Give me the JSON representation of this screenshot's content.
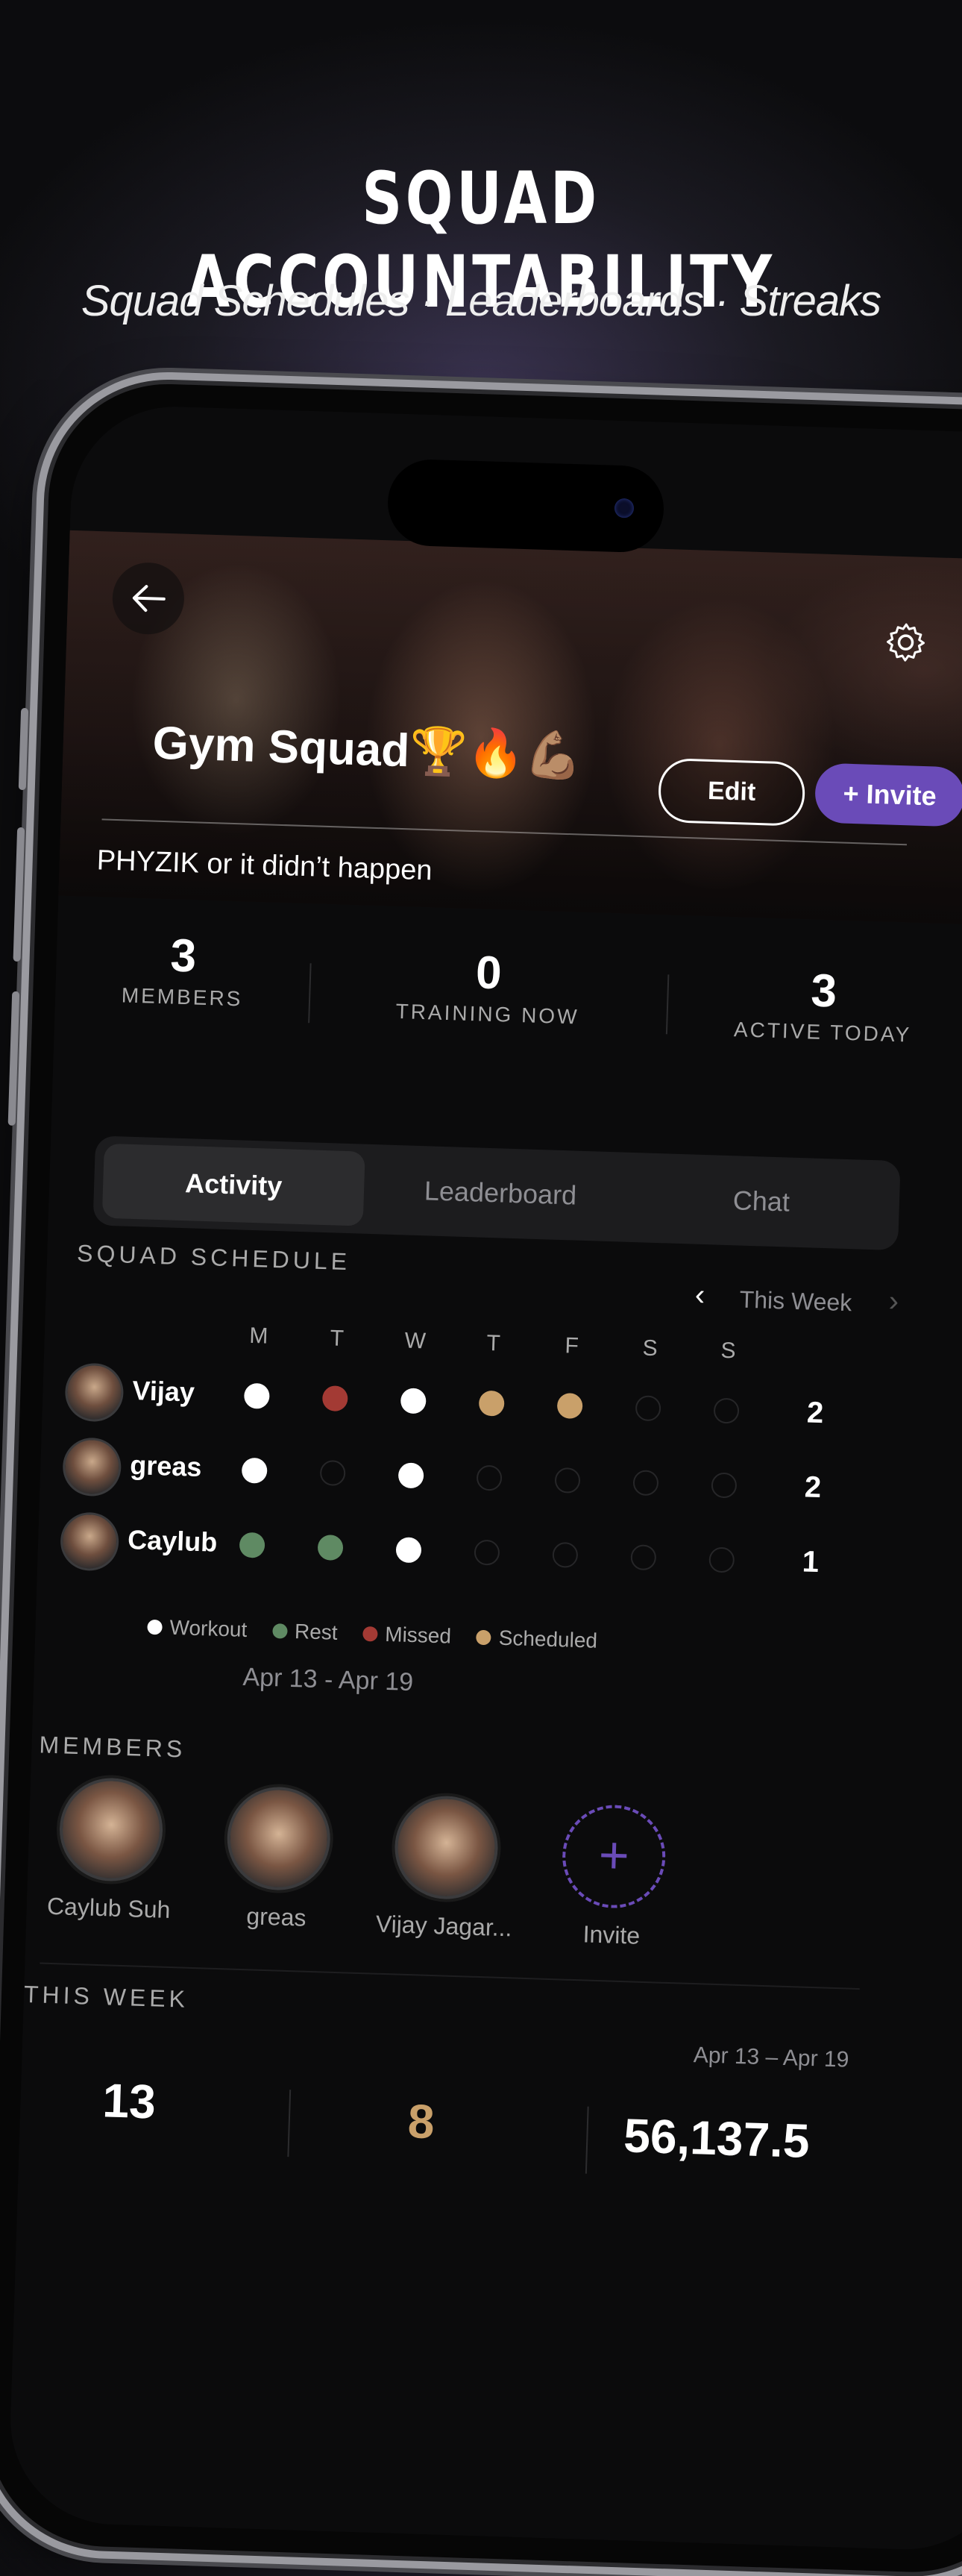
{
  "headline": "SQUAD ACCOUNTABILITY",
  "subline": "Squad Schedules · Leaderboards · Streaks",
  "squad": {
    "name": "Gym Squad🏆🔥💪🏽",
    "edit_label": "Edit",
    "invite_label": "+ Invite",
    "tagline": "PHYZIK or it didn’t happen"
  },
  "stats": [
    {
      "value": "3",
      "label": "MEMBERS"
    },
    {
      "value": "0",
      "label": "TRAINING NOW"
    },
    {
      "value": "3",
      "label": "ACTIVE TODAY"
    }
  ],
  "tabs": [
    "Activity",
    "Leaderboard",
    "Chat"
  ],
  "active_tab": "Activity",
  "schedule": {
    "title": "SQUAD SCHEDULE",
    "week_label": "This Week",
    "days": [
      "M",
      "T",
      "W",
      "T",
      "F",
      "S",
      "S"
    ],
    "rows": [
      {
        "name": "Vijay",
        "status": [
          "workout",
          "missed",
          "workout",
          "scheduled",
          "scheduled",
          "empty",
          "empty"
        ],
        "count": "2"
      },
      {
        "name": "greas",
        "status": [
          "workout",
          "empty",
          "workout",
          "empty",
          "empty",
          "empty",
          "empty"
        ],
        "count": "2"
      },
      {
        "name": "Caylub",
        "status": [
          "rest",
          "rest",
          "workout",
          "empty",
          "empty",
          "empty",
          "empty"
        ],
        "count": "1"
      }
    ],
    "legend": [
      {
        "label": "Workout",
        "color": "#ffffff"
      },
      {
        "label": "Rest",
        "color": "#5f8a63"
      },
      {
        "label": "Missed",
        "color": "#a33a34"
      },
      {
        "label": "Scheduled",
        "color": "#c9a06a"
      }
    ],
    "date_range": "Apr 13 - Apr 19"
  },
  "members": {
    "title": "MEMBERS",
    "list": [
      "Caylub Suh",
      "greas",
      "Vijay Jagar..."
    ],
    "invite_label": "Invite"
  },
  "this_week": {
    "title": "THIS WEEK",
    "date_range": "Apr 13 – Apr 19",
    "values": [
      "13",
      "8",
      "56,137.5"
    ]
  },
  "colors": {
    "accent": "#6a4bb8",
    "workout": "#ffffff",
    "rest": "#5f8a63",
    "missed": "#a33a34",
    "scheduled": "#c9a06a",
    "gold": "#c9a06a"
  }
}
